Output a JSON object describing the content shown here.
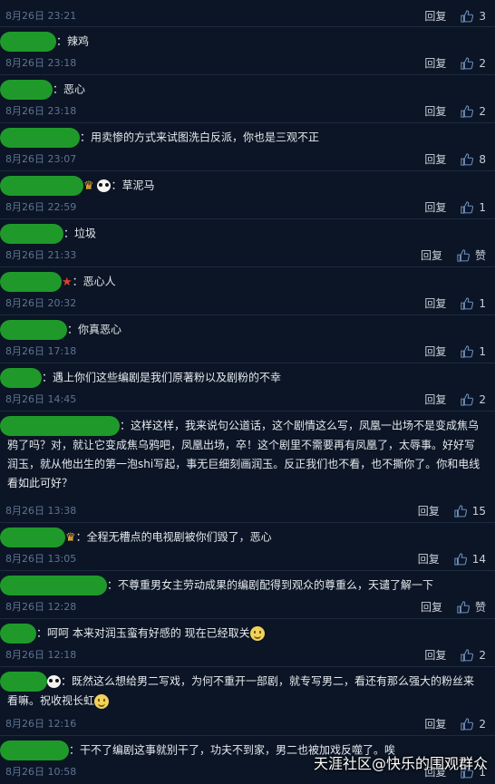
{
  "comments": [
    {
      "text": "",
      "prefix": "",
      "date": "8月26日 23:21",
      "reply": "回复",
      "likes": "3"
    },
    {
      "text": "：辣鸡",
      "prefix": "",
      "date": "8月26日 23:18",
      "reply": "回复",
      "likes": "2"
    },
    {
      "text": "：恶心",
      "prefix": "",
      "date": "8月26日 23:18",
      "reply": "回复",
      "likes": "2"
    },
    {
      "text": "：用卖惨的方式来试图洗白反派，你也是三观不正",
      "prefix": "",
      "date": "8月26日 23:07",
      "reply": "回复",
      "likes": "8"
    },
    {
      "text": "：草泥马",
      "prefix": "",
      "date": "8月26日 22:59",
      "reply": "回复",
      "likes": "1"
    },
    {
      "text": "：垃圾",
      "prefix": "",
      "date": "8月26日 21:33",
      "reply": "回复",
      "likes": "赞"
    },
    {
      "text": "：恶心人",
      "prefix": "",
      "date": "8月26日 20:32",
      "reply": "回复",
      "likes": "1"
    },
    {
      "text": "：你真恶心",
      "prefix": "",
      "date": "8月26日 17:18",
      "reply": "回复",
      "likes": "1"
    },
    {
      "text": "：遇上你们这些编剧是我们原著粉以及剧粉的不幸",
      "prefix": "",
      "date": "8月26日 14:45",
      "reply": "回复",
      "likes": "2"
    },
    {
      "text": "：这样这样，我来说句公道话，这个剧情这么写，凤凰一出场不是变成焦乌鸦了吗？对，就让它变成焦乌鸦吧，凤凰出场，卒！这个剧里不需要再有凤凰了，太辱事。好好写润玉，就从他出生的第一泡shi写起，事无巨细刻画润玉。反正我们也不看，也不撕你了。你和电线看如此可好？",
      "prefix": "",
      "date": "8月26日 13:38",
      "reply": "回复",
      "likes": "15"
    },
    {
      "text": "：全程无槽点的电视剧被你们毁了，恶心",
      "prefix": "",
      "date": "8月26日 13:05",
      "reply": "回复",
      "likes": "14"
    },
    {
      "text": "：不尊重男女主劳动成果的编剧配得到观众的尊重么，天谴了解一下",
      "prefix": "",
      "date": "8月26日 12:28",
      "reply": "回复",
      "likes": "赞"
    },
    {
      "text": "：呵呵 本来对润玉蛮有好感的 现在已经取关",
      "prefix": "",
      "date": "8月26日 12:18",
      "reply": "回复",
      "likes": "2"
    },
    {
      "text": "：既然这么想给男二写戏，为何不重开一部剧，就专写男二，看还有那么强大的粉丝来看嘛。祝收视长虹",
      "prefix": "",
      "date": "8月26日 12:16",
      "reply": "回复",
      "likes": "2"
    },
    {
      "text": "：干不了编剧这事就别干了，功夫不到家，男二也被加戏反噬了。唉",
      "prefix": "",
      "date": "8月26日 10:58",
      "reply": "回复",
      "likes": "1"
    }
  ],
  "watermark": "天涯社区@快乐的围观群众"
}
